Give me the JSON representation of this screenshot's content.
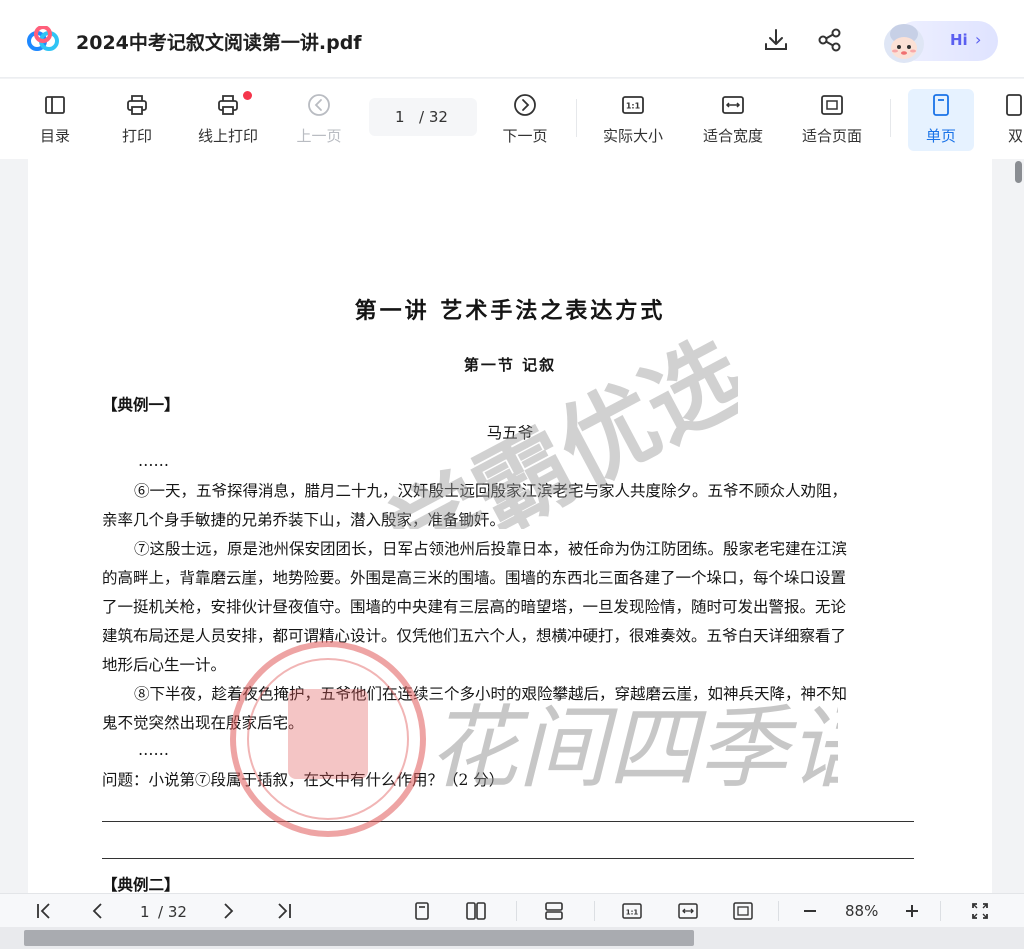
{
  "header": {
    "file_title": "2024中考记叙文阅读第一讲.pdf",
    "assistant_label": "Hi",
    "assistant_chevron": "›"
  },
  "toolbar": {
    "items": [
      {
        "label": "目录",
        "icon": "outline-icon"
      },
      {
        "label": "打印",
        "icon": "print-icon"
      },
      {
        "label": "线上打印",
        "icon": "online-print-icon"
      },
      {
        "label": "上一页",
        "icon": "prev-page-icon"
      },
      {
        "label": "下一页",
        "icon": "next-page-icon"
      },
      {
        "label": "实际大小",
        "icon": "actual-size-icon"
      },
      {
        "label": "适合宽度",
        "icon": "fit-width-icon"
      },
      {
        "label": "适合页面",
        "icon": "fit-page-icon"
      },
      {
        "label": "单页",
        "icon": "single-page-icon"
      },
      {
        "label": "双",
        "icon": "double-page-icon"
      }
    ],
    "page_current": "1",
    "page_total": "/ 32"
  },
  "document": {
    "title": "第一讲  艺术手法之表达方式",
    "section": "第一节  记叙",
    "example1_label": "【典例一】",
    "story_title": "马五爷",
    "ellipsis1": "……",
    "para6_line1": "⑥一天，五爷探得消息，腊月二十九，汉奸殷士远回殷家江滨老宅与家人共度除夕。五爷不顾众人劝阻，",
    "para6_line2": "亲率几个身手敏捷的兄弟乔装下山，潜入殷家，准备锄奸。",
    "para7_line1": "⑦这殷士远，原是池州保安团团长，日军占领池州后投靠日本，被任命为伪江防团练。殷家老宅建在江滨",
    "para7_line2": "的高畔上，背靠磨云崖，地势险要。外围是高三米的围墙。围墙的东西北三面各建了一个垛口，每个垛口设置",
    "para7_line3": "了一挺机关枪，安排伙计昼夜值守。围墙的中央建有三层高的暗望塔，一旦发现险情，随时可发出警报。无论",
    "para7_line4": "建筑布局还是人员安排，都可谓精心设计。仅凭他们五六个人，想横冲硬打，很难奏效。五爷白天详细察看了",
    "para7_line5": "地形后心生一计。",
    "para8_line1": "⑧下半夜，趁着夜色掩护，五爷他们在连续三个多小时的艰险攀越后，穿越磨云崖，如神兵天降，神不知",
    "para8_line2": "鬼不觉突然出现在殷家后宅。",
    "ellipsis2": "……",
    "question": "问题：小说第⑦段属于插叙，在文中有什么作用？（2 分）",
    "example2_label": "【典例二】",
    "watermark_top": "学霸优选",
    "watermark_bottom": "花间四季语文"
  },
  "bottombar": {
    "page_current": "1",
    "page_total": "/ 32",
    "zoom": "88%"
  },
  "colors": {
    "accent": "#1a73e8",
    "red_dot": "#f5354b",
    "watermark_red": "#e05a5a"
  }
}
